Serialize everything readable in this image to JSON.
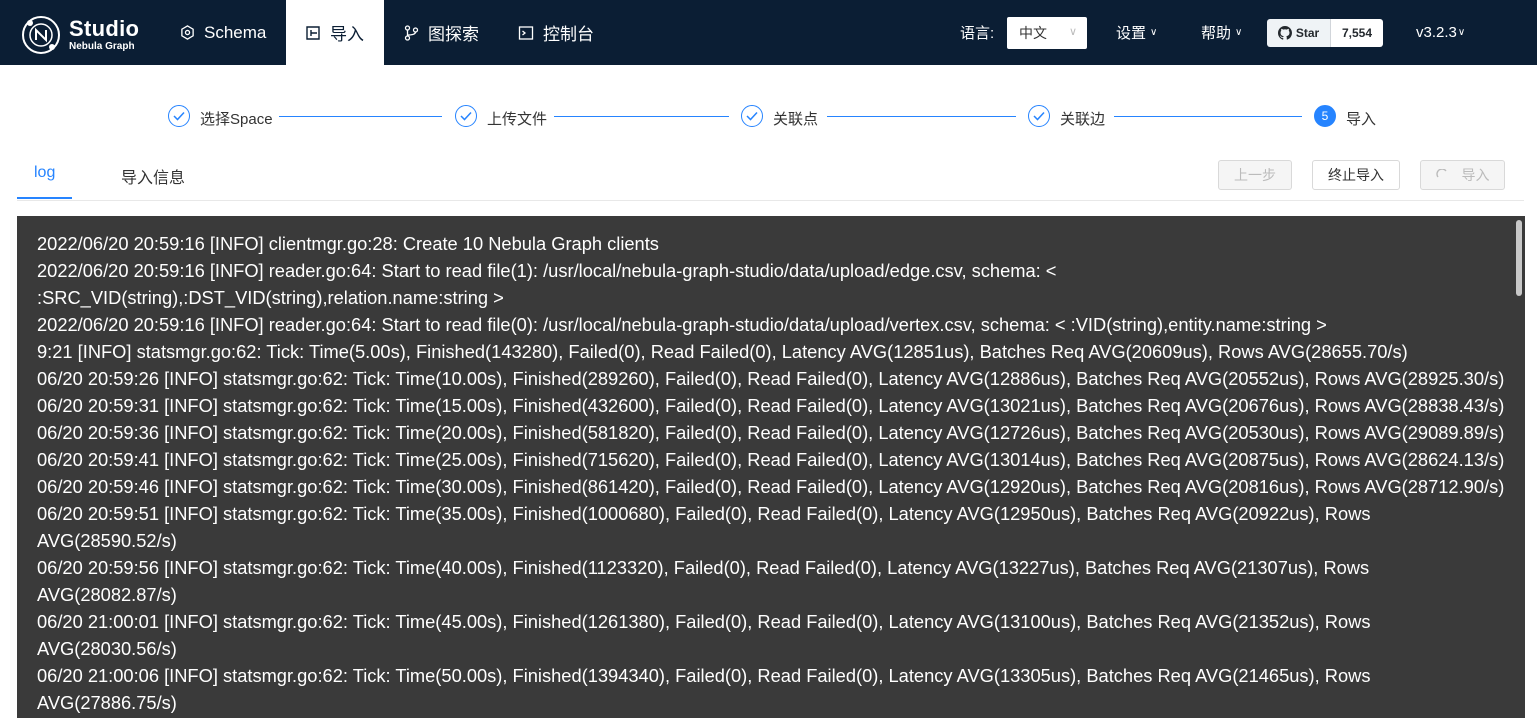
{
  "app": {
    "title": "Studio",
    "subtitle": "Nebula Graph"
  },
  "nav": {
    "items": [
      {
        "label": "Schema",
        "icon": "schema-icon"
      },
      {
        "label": "导入",
        "icon": "import-icon",
        "active": true
      },
      {
        "label": "图探索",
        "icon": "explore-icon"
      },
      {
        "label": "控制台",
        "icon": "console-icon"
      }
    ],
    "language_label": "语言:",
    "language_value": "中文",
    "settings_label": "设置",
    "help_label": "帮助",
    "github_star_label": "Star",
    "github_star_count": "7,554",
    "version": "v3.2.3"
  },
  "steps": [
    {
      "label": "选择Space",
      "state": "done"
    },
    {
      "label": "上传文件",
      "state": "done"
    },
    {
      "label": "关联点",
      "state": "done"
    },
    {
      "label": "关联边",
      "state": "done"
    },
    {
      "label": "导入",
      "state": "current",
      "number": "5"
    }
  ],
  "tabs": [
    {
      "label": "log",
      "active": true
    },
    {
      "label": "导入信息",
      "active": false
    }
  ],
  "actions": {
    "prev_label": "上一步",
    "stop_label": "终止导入",
    "import_label": "导入"
  },
  "log_lines": [
    "2022/06/20 20:59:16 [INFO] clientmgr.go:28: Create 10 Nebula Graph clients",
    "2022/06/20 20:59:16 [INFO] reader.go:64: Start to read file(1): /usr/local/nebula-graph-studio/data/upload/edge.csv, schema: < :SRC_VID(string),:DST_VID(string),relation.name:string >",
    "2022/06/20 20:59:16 [INFO] reader.go:64: Start to read file(0): /usr/local/nebula-graph-studio/data/upload/vertex.csv, schema: < :VID(string),entity.name:string >",
    "9:21 [INFO] statsmgr.go:62: Tick: Time(5.00s), Finished(143280), Failed(0), Read Failed(0), Latency AVG(12851us), Batches Req AVG(20609us), Rows AVG(28655.70/s)",
    "06/20 20:59:26 [INFO] statsmgr.go:62: Tick: Time(10.00s), Finished(289260), Failed(0), Read Failed(0), Latency AVG(12886us), Batches Req AVG(20552us), Rows AVG(28925.30/s)",
    "06/20 20:59:31 [INFO] statsmgr.go:62: Tick: Time(15.00s), Finished(432600), Failed(0), Read Failed(0), Latency AVG(13021us), Batches Req AVG(20676us), Rows AVG(28838.43/s)",
    "06/20 20:59:36 [INFO] statsmgr.go:62: Tick: Time(20.00s), Finished(581820), Failed(0), Read Failed(0), Latency AVG(12726us), Batches Req AVG(20530us), Rows AVG(29089.89/s)",
    "06/20 20:59:41 [INFO] statsmgr.go:62: Tick: Time(25.00s), Finished(715620), Failed(0), Read Failed(0), Latency AVG(13014us), Batches Req AVG(20875us), Rows AVG(28624.13/s)",
    "06/20 20:59:46 [INFO] statsmgr.go:62: Tick: Time(30.00s), Finished(861420), Failed(0), Read Failed(0), Latency AVG(12920us), Batches Req AVG(20816us), Rows AVG(28712.90/s)",
    "06/20 20:59:51 [INFO] statsmgr.go:62: Tick: Time(35.00s), Finished(1000680), Failed(0), Read Failed(0), Latency AVG(12950us), Batches Req AVG(20922us), Rows AVG(28590.52/s)",
    "06/20 20:59:56 [INFO] statsmgr.go:62: Tick: Time(40.00s), Finished(1123320), Failed(0), Read Failed(0), Latency AVG(13227us), Batches Req AVG(21307us), Rows AVG(28082.87/s)",
    "06/20 21:00:01 [INFO] statsmgr.go:62: Tick: Time(45.00s), Finished(1261380), Failed(0), Read Failed(0), Latency AVG(13100us), Batches Req AVG(21352us), Rows AVG(28030.56/s)",
    "06/20 21:00:06 [INFO] statsmgr.go:62: Tick: Time(50.00s), Finished(1394340), Failed(0), Read Failed(0), Latency AVG(13305us), Batches Req AVG(21465us), Rows AVG(27886.75/s)"
  ],
  "colors": {
    "nav_bg": "#0b1e34",
    "accent": "#2684ff",
    "log_bg": "#3a3a3a"
  }
}
